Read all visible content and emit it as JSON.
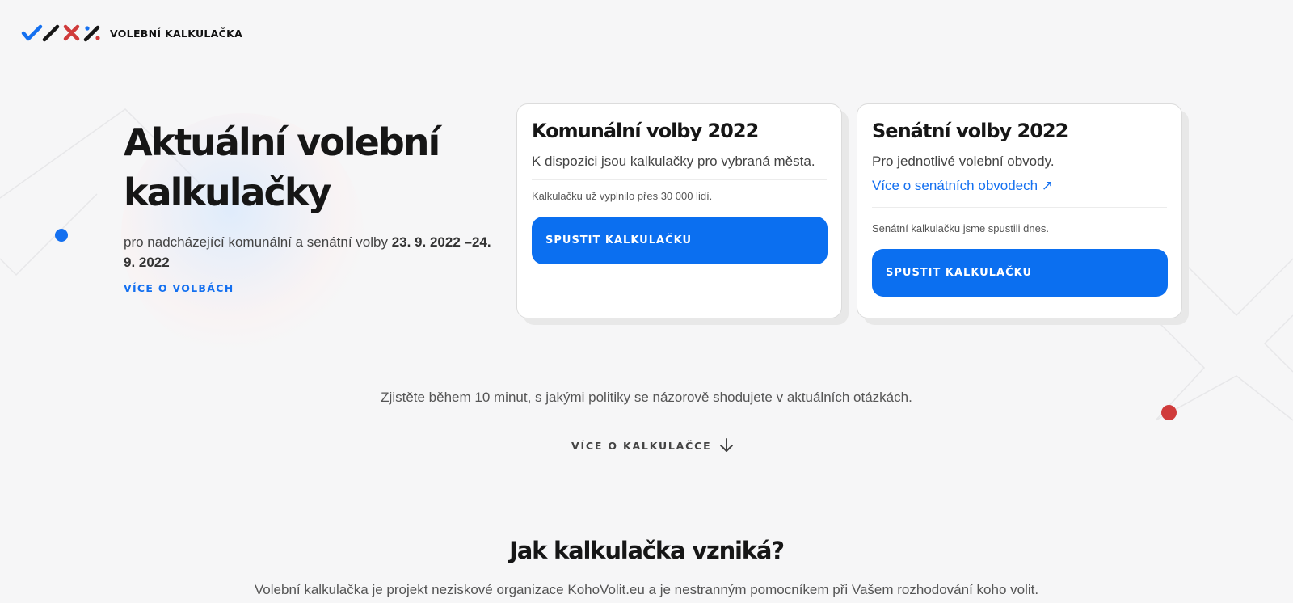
{
  "header": {
    "brand": "VOLEBNÍ KALKULAČKA",
    "logo_icons": [
      "check-icon",
      "slash-icon",
      "cross-icon",
      "percent-icon"
    ],
    "logo_colors": {
      "check": "#1470f0",
      "slash": "#161616",
      "cross": "#d03b3b",
      "percent": "#161616"
    }
  },
  "hero": {
    "title_line1": "Aktuální volební",
    "title_line2": "kalkulačky",
    "subtitle_prefix": "pro nadcházející komunální a senátní volby ",
    "subtitle_dates": "23. 9. 2022 –24. 9. 2022",
    "link_label": "VÍCE O VOLBÁCH"
  },
  "cards": {
    "communal": {
      "title": "Komunální volby 2022",
      "description": "K dispozici jsou kalkulačky pro vybraná města.",
      "note": "Kalkulačku už vyplnilo přes 30 000 lidí.",
      "button_label": "SPUSTIT KALKULAČKU"
    },
    "senate": {
      "title": "Senátní volby 2022",
      "description": "Pro jednotlivé volební obvody.",
      "link_label": "Více o senátních obvodech ↗",
      "note": "Senátní kalkulačku jsme spustili dnes.",
      "button_label": "SPUSTIT KALKULAČKU"
    }
  },
  "tagline": "Zjistěte během 10 minut, s jakými politiky se názorově shodujete v aktuálních otázkách.",
  "more_link": {
    "label": "VÍCE O KALKULAČCE",
    "icon": "arrow-down-icon"
  },
  "section": {
    "title": "Jak kalkulačka vzniká?",
    "description": "Volební kalkulačka je projekt neziskové organizace KohoVolit.eu a je nestranným pomocníkem při Vašem rozhodování koho volit."
  },
  "colors": {
    "accent": "#0b6ff0",
    "link": "#1470f0",
    "red": "#d03b3b",
    "background": "#f6f6f7"
  }
}
